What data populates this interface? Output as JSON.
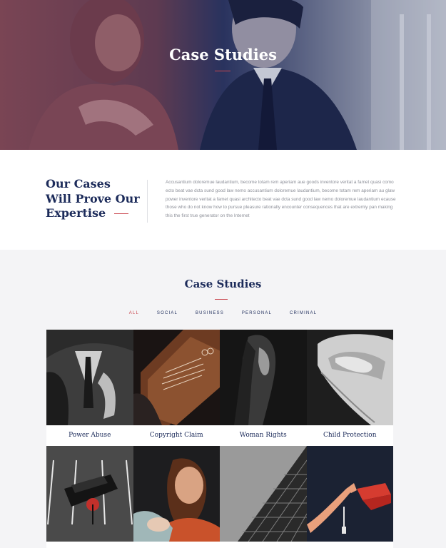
{
  "hero": {
    "title": "Case Studies"
  },
  "intro": {
    "heading_lines": [
      "Our Cases",
      "Will Prove Our",
      "Expertise"
    ],
    "paragraph": "Accusantium doloremue laudantium, become totam rem aperiam aue goods inventore veritat a famet quasi como ecto beat vae dcta sund good law nemo accusantium doloremue laudantium, become totam rem aperiam au glaw power inventore veritat a famet quasi architecto beat vae dcta sund good law nemo  doloremue laudantium ecause those who do not know how to pursue pleasure rationally encounter consequences that are extremly pan making this the first true generator on the Internet"
  },
  "cases": {
    "title": "Case Studies",
    "filters": [
      "ALL",
      "SOCIAL",
      "BUSINESS",
      "PERSONAL",
      "CRIMINAL"
    ],
    "active_filter": "ALL",
    "items": [
      {
        "caption": "Power Abuse",
        "icon": "suit-photo"
      },
      {
        "caption": "Copyright Claim",
        "icon": "book-photo"
      },
      {
        "caption": "Woman Rights",
        "icon": "woman-photo"
      },
      {
        "caption": "Child Protection",
        "icon": "hands-photo"
      },
      {
        "caption": "",
        "icon": "parking-car-photo"
      },
      {
        "caption": "",
        "icon": "smiling-woman-photo"
      },
      {
        "caption": "",
        "icon": "building-photo"
      },
      {
        "caption": "",
        "icon": "graduation-cap-photo"
      }
    ]
  },
  "colors": {
    "navy": "#1c2b5a",
    "accent_red": "#c9464e",
    "gray_text": "#8c8f98"
  }
}
